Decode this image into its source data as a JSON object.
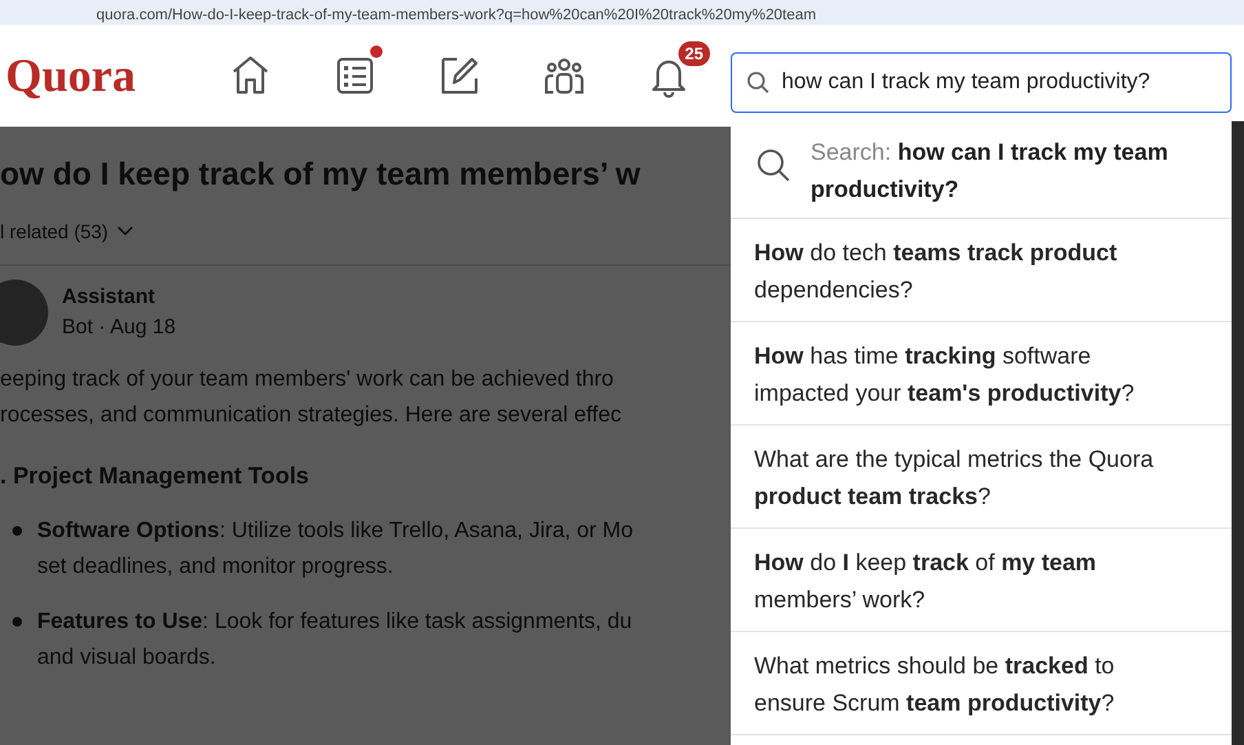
{
  "address_bar": {
    "url": "quora.com/How-do-I-keep-track-of-my-team-members-work?q=how%20can%20I%20track%20my%20team"
  },
  "header": {
    "logo": "Quora",
    "nav": [
      {
        "kind": "home",
        "dot": false
      },
      {
        "kind": "list",
        "dot": true
      },
      {
        "kind": "edit",
        "dot": false
      },
      {
        "kind": "people",
        "dot": false
      },
      {
        "kind": "bell",
        "badge": "25"
      }
    ],
    "search": {
      "value": "how can I track my team productivity?"
    }
  },
  "question": {
    "title": "ow do I keep track of my team members’ w",
    "related": "l related (53)",
    "author": "Assistant",
    "meta": "Bot · Aug 18",
    "intro": [
      "eeping track of your team members' work can be achieved thro",
      "rocesses, and communication strategies. Here are several effec"
    ],
    "heading": ". Project Management Tools",
    "bullets": [
      {
        "lines": [
          "**Software Options**: Utilize tools like Trello, Asana, Jira, or Mo",
          "set deadlines, and monitor progress."
        ]
      },
      {
        "lines": [
          "**Features to Use**: Look for features like task assignments, du",
          "and visual boards."
        ]
      }
    ]
  },
  "dropdown": {
    "search_label": "Search:",
    "search_query": "how can I track my team productivity?",
    "suggestions": [
      "**How** do tech **teams track product** dependencies?",
      "**How** has time **tracking** software impacted your **team's productivity**?",
      "What are the typical metrics the Quora **product team tracks**?",
      "**How** do **I** keep **track** of **my team** members’ work?",
      "What metrics should be **tracked** to ensure Scrum **team productivity**?"
    ]
  }
}
